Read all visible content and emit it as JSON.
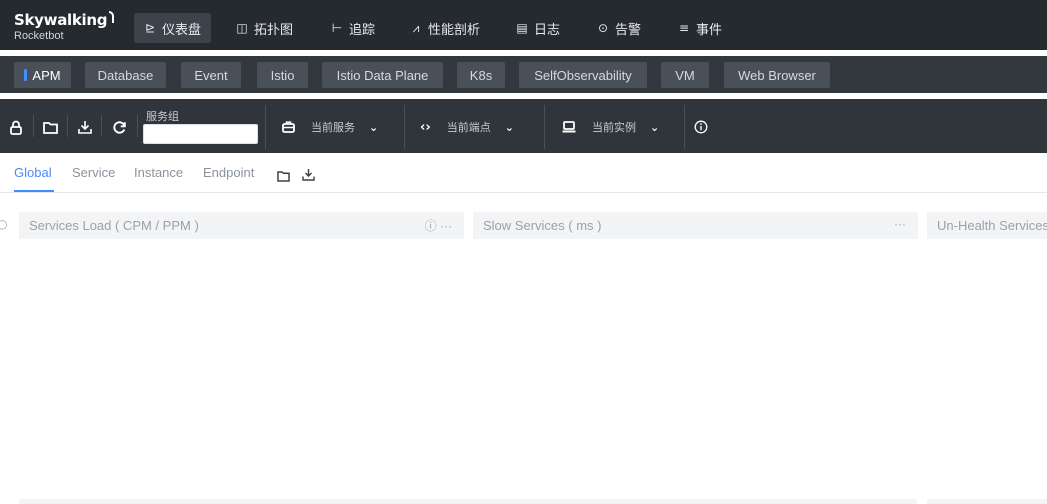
{
  "logo": {
    "title": "Skywalking",
    "subtitle": "Rocketbot"
  },
  "nav": [
    {
      "icon": "dashboard-icon",
      "glyph": "⊵",
      "label": "仪表盘",
      "active": true
    },
    {
      "icon": "topology-icon",
      "glyph": "◫",
      "label": "拓扑图",
      "active": false
    },
    {
      "icon": "trace-icon",
      "glyph": "⊢",
      "label": "追踪",
      "active": false
    },
    {
      "icon": "profile-icon",
      "glyph": "⩘",
      "label": "性能剖析",
      "active": false
    },
    {
      "icon": "log-icon",
      "glyph": "▤",
      "label": "日志",
      "active": false
    },
    {
      "icon": "alarm-icon",
      "glyph": "⊙",
      "label": "告警",
      "active": false
    },
    {
      "icon": "event-icon",
      "glyph": "≡",
      "label": "事件",
      "active": false
    }
  ],
  "tabs": [
    "APM",
    "Database",
    "Event",
    "Istio",
    "Istio Data Plane",
    "K8s",
    "SelfObservability",
    "VM",
    "Web Browser"
  ],
  "toolbar": {
    "group_label": "服务组",
    "group_value": "",
    "service_placeholder": "当前服务",
    "endpoint_placeholder": "当前端点",
    "instance_placeholder": "当前实例"
  },
  "dashboard_tabs": [
    "Global",
    "Service",
    "Instance",
    "Endpoint"
  ],
  "panels": [
    {
      "title": "Services Load ( CPM / PPM )",
      "tools": "ⓘ ···"
    },
    {
      "title": "Slow Services ( ms )",
      "tools": "···"
    },
    {
      "title": "Un-Health Services",
      "tools": ""
    }
  ],
  "colors": {
    "accent": "#448dfe",
    "nav_bg": "#252a2f",
    "tab_bg": "#32383e",
    "toolbar_bg": "#2f353b"
  }
}
